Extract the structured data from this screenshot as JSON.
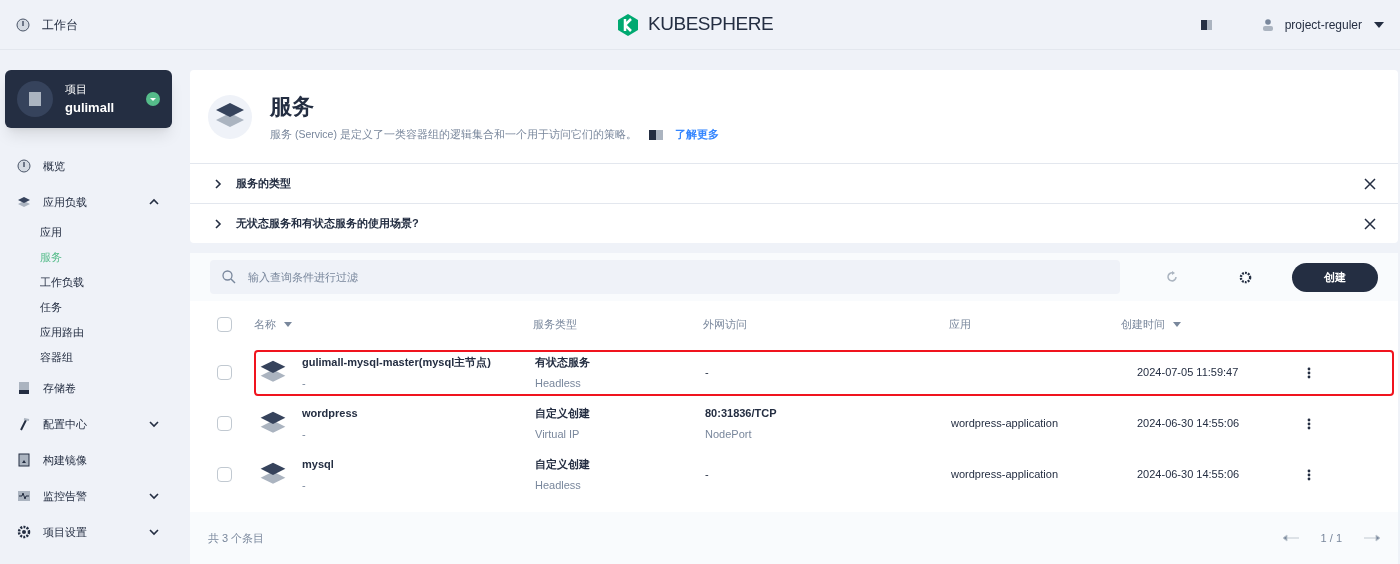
{
  "topbar": {
    "workbench": "工作台",
    "logo": "KUBESPHERE",
    "user": "project-reguler"
  },
  "project": {
    "label": "项目",
    "name": "gulimall"
  },
  "sidebar": {
    "items": [
      {
        "label": "概览"
      },
      {
        "label": "应用负载",
        "expanded": true,
        "children": [
          {
            "label": "应用",
            "selected": false
          },
          {
            "label": "服务",
            "selected": true
          },
          {
            "label": "工作负载",
            "selected": false
          },
          {
            "label": "任务",
            "selected": false
          },
          {
            "label": "应用路由",
            "selected": false
          },
          {
            "label": "容器组",
            "selected": false
          }
        ]
      },
      {
        "label": "存储卷"
      },
      {
        "label": "配置中心",
        "expanded": false
      },
      {
        "label": "构建镜像"
      },
      {
        "label": "监控告警",
        "expanded": false
      },
      {
        "label": "项目设置",
        "expanded": false
      }
    ]
  },
  "header": {
    "title": "服务",
    "description": "服务 (Service) 是定义了一类容器组的逻辑集合和一个用于访问它们的策略。",
    "learn_more": "了解更多"
  },
  "tips": [
    {
      "title": "服务的类型",
      "expanded": false
    },
    {
      "title": "无状态服务和有状态服务的使用场景?",
      "expanded": false
    }
  ],
  "toolbar": {
    "search_placeholder": "输入查询条件进行过滤",
    "create": "创建"
  },
  "table": {
    "select_all_checked": false,
    "columns": [
      {
        "label": "名称",
        "sortable": true
      },
      {
        "label": "服务类型",
        "sortable": false
      },
      {
        "label": "外网访问",
        "sortable": false
      },
      {
        "label": "应用",
        "sortable": false
      },
      {
        "label": "创建时间",
        "sortable": true
      }
    ],
    "rows": [
      {
        "name": "gulimall-mysql-master(mysql主节点)",
        "alias": "-",
        "type": "有状态服务",
        "type_sub": "Headless",
        "access": "-",
        "created": "2024-07-05 11:59:47",
        "checked": false,
        "highlighted": true
      },
      {
        "name": "wordpress",
        "alias": "-",
        "type": "自定义创建",
        "type_sub": "Virtual IP",
        "access": "80:31836/TCP",
        "access_sub": "NodePort",
        "app": "wordpress-application",
        "created": "2024-06-30 14:55:06",
        "checked": false,
        "highlighted": false
      },
      {
        "name": "mysql",
        "alias": "-",
        "type": "自定义创建",
        "type_sub": "Headless",
        "access": "-",
        "app": "wordpress-application",
        "created": "2024-06-30 14:55:06",
        "checked": false,
        "highlighted": false
      }
    ]
  },
  "footer": {
    "total": "共 3 个条目",
    "page": "1 / 1"
  }
}
